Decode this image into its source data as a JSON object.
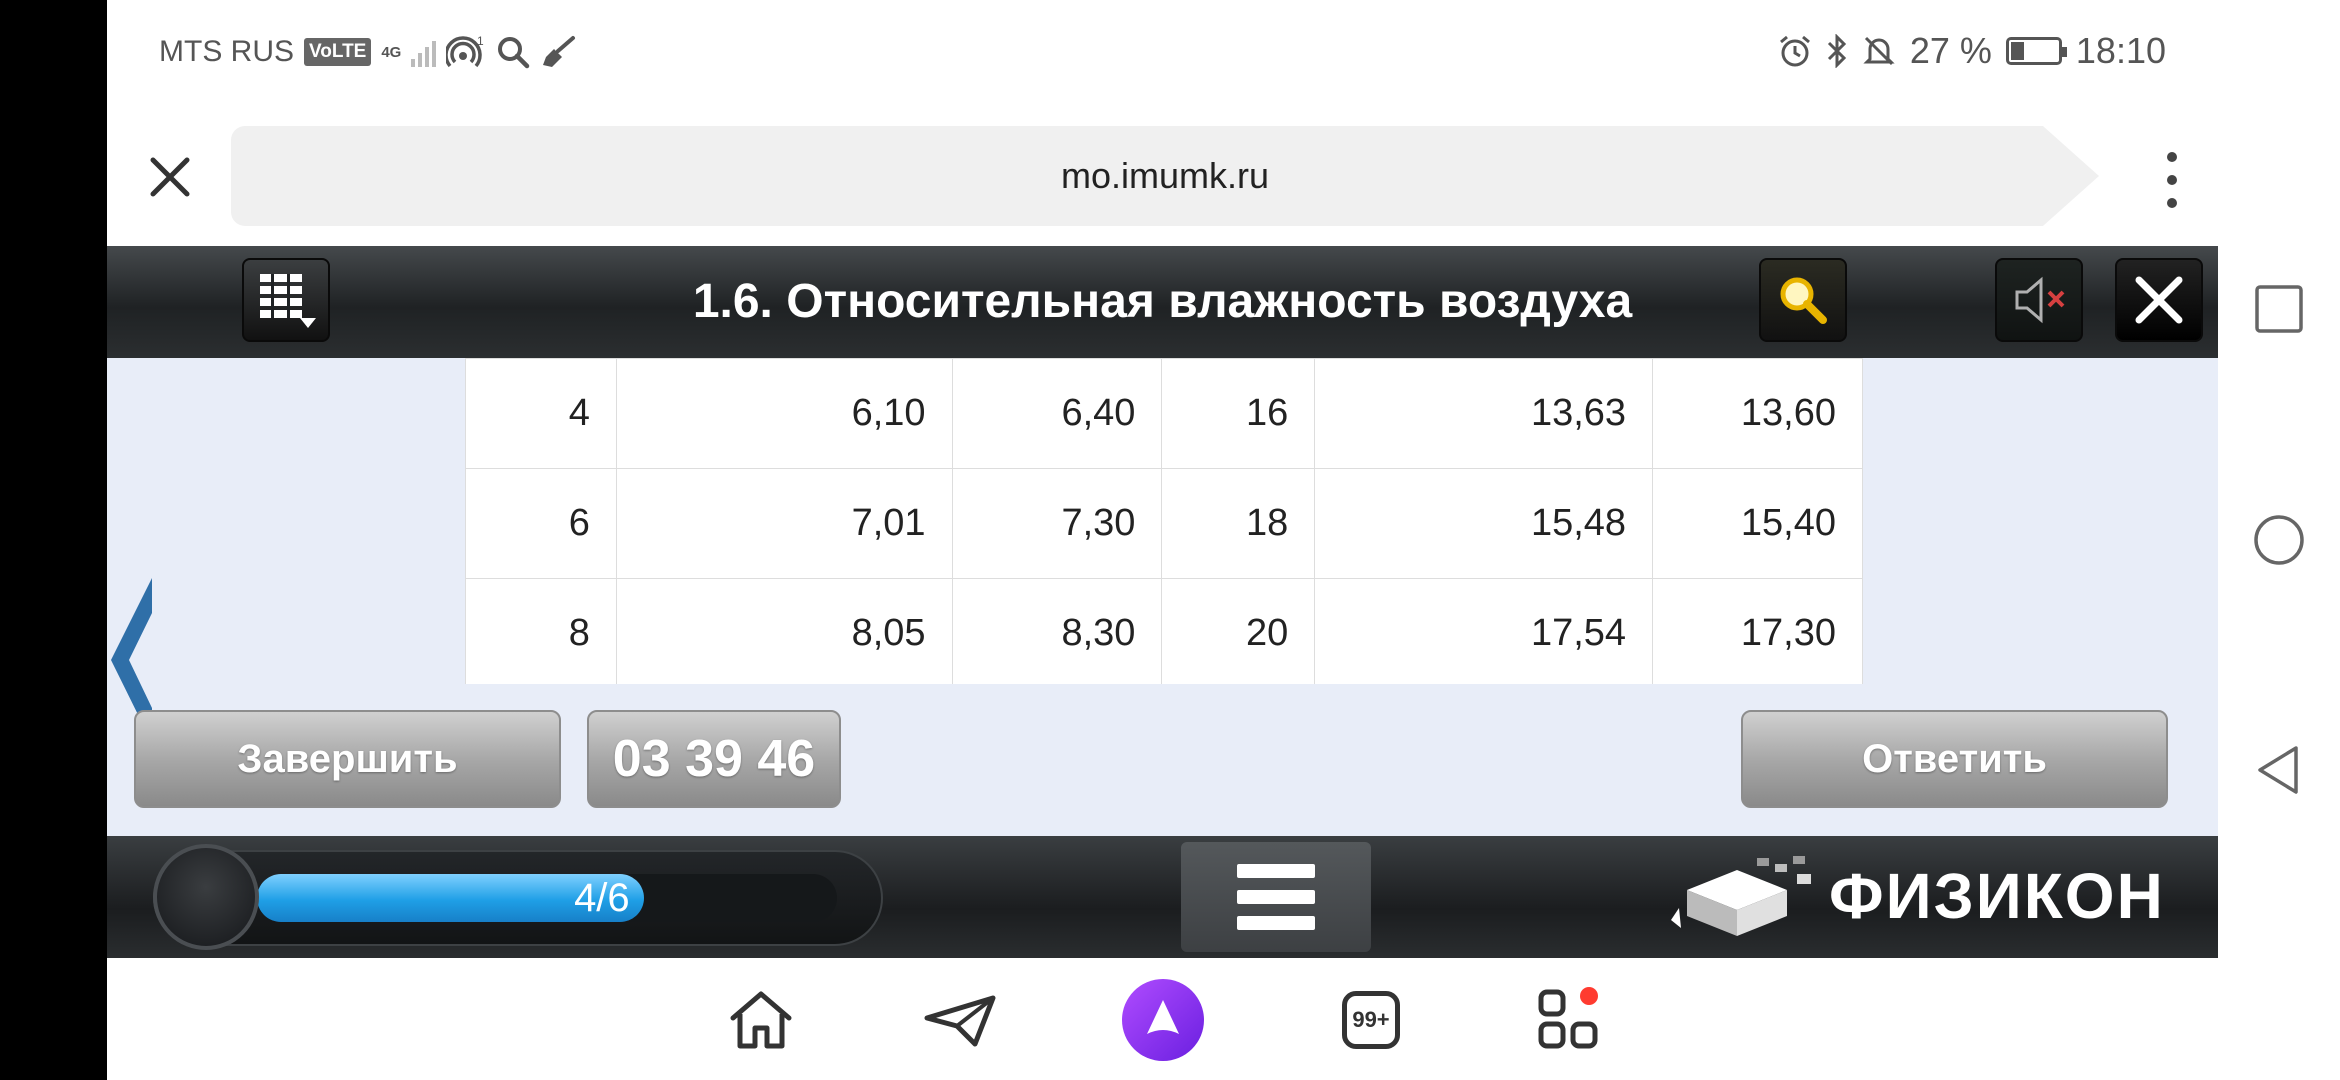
{
  "status_bar": {
    "carrier": "MTS RUS",
    "volte": "VoLTE",
    "network": "4G",
    "battery_percent": "27 %",
    "time": "18:10",
    "left_icons": [
      "volte-badge",
      "signal-icon",
      "hotspot-icon",
      "search-icon",
      "broom-icon"
    ],
    "right_icons": [
      "alarm-icon",
      "bluetooth-icon",
      "bell-off-icon",
      "battery-icon"
    ]
  },
  "browser": {
    "url": "mo.imumk.ru"
  },
  "app": {
    "title": "1.6. Относительная влажность воздуха",
    "table": {
      "rows": [
        [
          "4",
          "6,10",
          "6,40",
          "16",
          "13,63",
          "13,60"
        ],
        [
          "6",
          "7,01",
          "7,30",
          "18",
          "15,48",
          "15,40"
        ],
        [
          "8",
          "8,05",
          "8,30",
          "20",
          "17,54",
          "17,30"
        ]
      ]
    },
    "finish_label": "Завершить",
    "timer": "03 39 46",
    "answer_label": "Ответить",
    "progress": {
      "label": "4/6",
      "fraction": 0.6667
    },
    "logo_text": "ФИЗИКОН"
  },
  "colors": {
    "accent_blue": "#1f9fe6",
    "content_bg": "#e8edf8",
    "alice_purple": "#8a2be2"
  }
}
